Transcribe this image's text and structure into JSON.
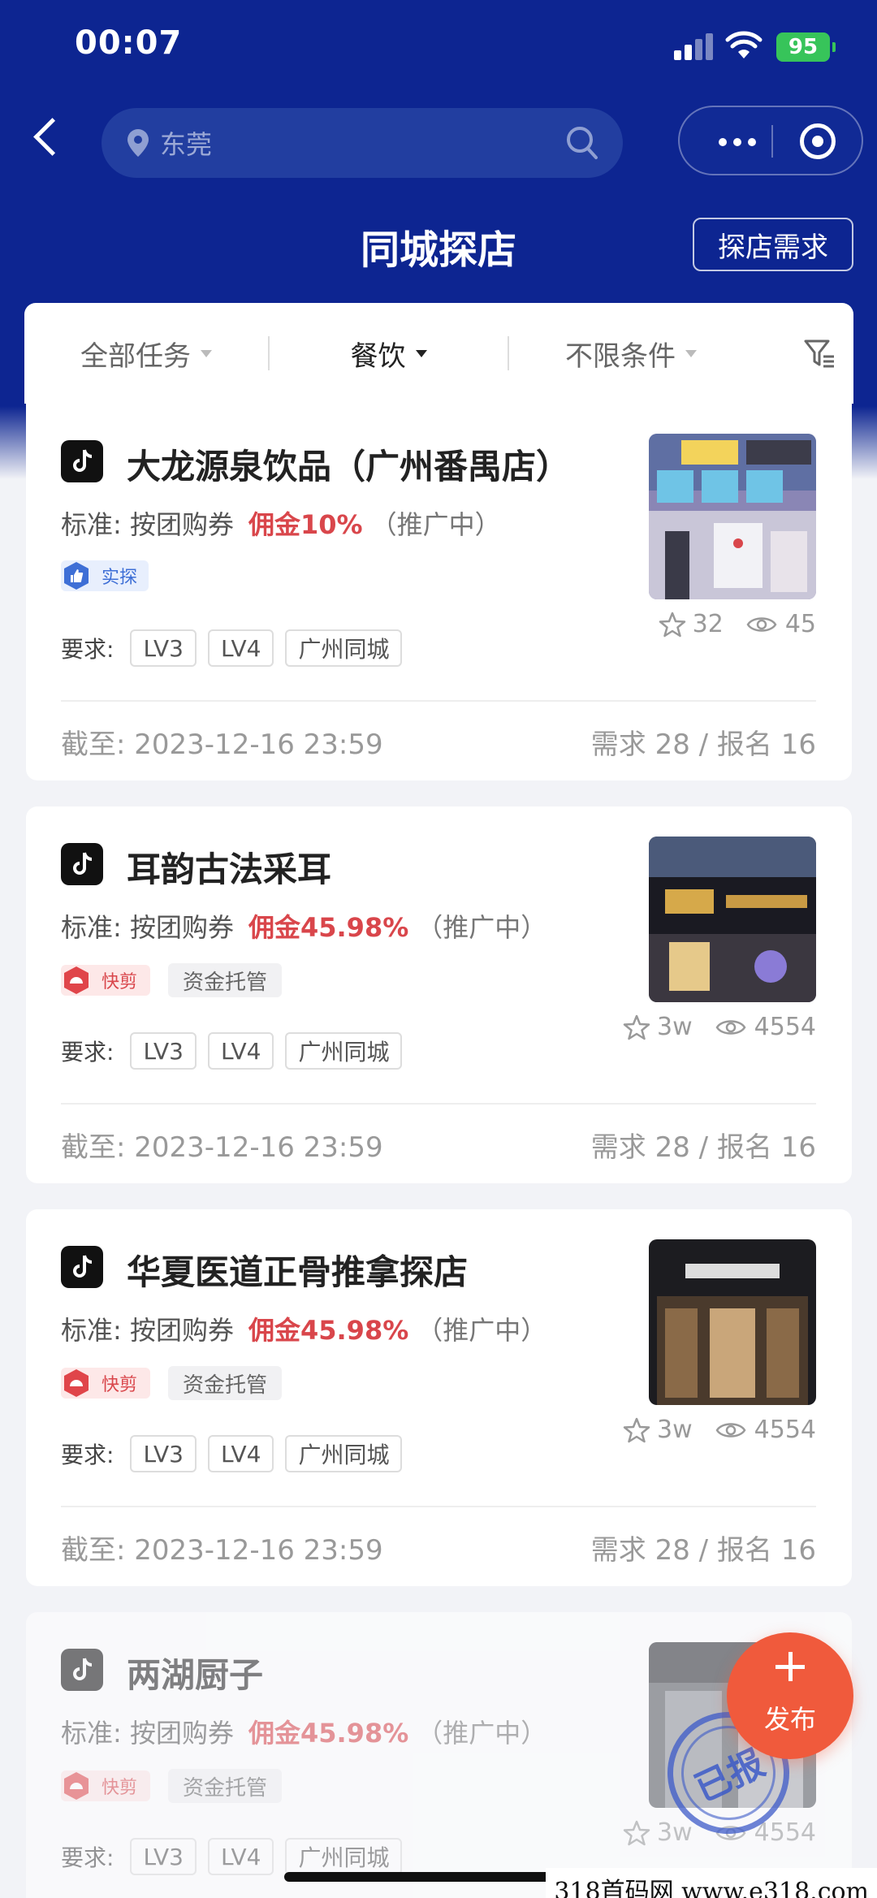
{
  "status_bar": {
    "time": "00:07",
    "battery": "95"
  },
  "nav": {
    "search_placeholder": "东莞",
    "title": "同城探店",
    "demand_button": "探店需求"
  },
  "filters": [
    {
      "label": "全部任务",
      "active": false
    },
    {
      "label": "餐饮",
      "active": true
    },
    {
      "label": "不限条件",
      "active": false
    }
  ],
  "cards": [
    {
      "title": "大龙源泉饮品（广州番禺店）",
      "standard_label": "标准:",
      "standard_value": "按团购券",
      "commission": "佣金10%",
      "promo": "（推广中）",
      "badge_primary": "实探",
      "badge_secondary": "",
      "req_label": "要求:",
      "reqs": [
        "LV3",
        "LV4",
        "广州同城"
      ],
      "stars": "32",
      "views": "45",
      "deadline": "截至: 2023-12-16 23:59",
      "counts": "需求 28 / 报名 16"
    },
    {
      "title": "耳韵古法采耳",
      "standard_label": "标准:",
      "standard_value": "按团购券",
      "commission": "佣金45.98%",
      "promo": "（推广中）",
      "badge_primary": "快剪",
      "badge_secondary": "资金托管",
      "req_label": "要求:",
      "reqs": [
        "LV3",
        "LV4",
        "广州同城"
      ],
      "stars": "3w",
      "views": "4554",
      "deadline": "截至: 2023-12-16 23:59",
      "counts": "需求 28 / 报名 16"
    },
    {
      "title": "华夏医道正骨推拿探店",
      "standard_label": "标准:",
      "standard_value": "按团购券",
      "commission": "佣金45.98%",
      "promo": "（推广中）",
      "badge_primary": "快剪",
      "badge_secondary": "资金托管",
      "req_label": "要求:",
      "reqs": [
        "LV3",
        "LV4",
        "广州同城"
      ],
      "stars": "3w",
      "views": "4554",
      "deadline": "截至: 2023-12-16 23:59",
      "counts": "需求 28 / 报名 16"
    },
    {
      "title": "两湖厨子",
      "standard_label": "标准:",
      "standard_value": "按团购券",
      "commission": "佣金45.98%",
      "promo": "（推广中）",
      "badge_primary": "快剪",
      "badge_secondary": "资金托管",
      "req_label": "要求:",
      "reqs": [
        "LV3",
        "LV4",
        "广州同城"
      ],
      "stars": "3w",
      "views": "4554",
      "deadline": "",
      "counts": "",
      "stamp": "已报"
    }
  ],
  "publish_button": "发布",
  "watermark": "318首码网 www.e318.com",
  "colors": {
    "header": "#0d2591",
    "commission": "#d9464b",
    "publish": "#f05a3c"
  }
}
